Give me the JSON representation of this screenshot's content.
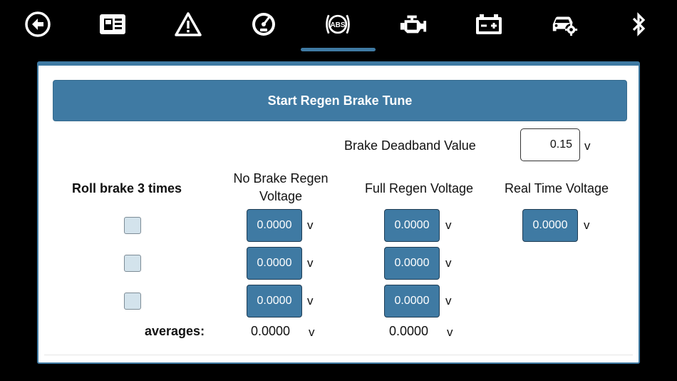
{
  "toolbar": {
    "icons": [
      "back-icon",
      "dashboard-icon",
      "warning-icon",
      "gauge-icon",
      "abs-icon",
      "engine-icon",
      "battery-icon",
      "car-settings-icon",
      "bluetooth-icon"
    ],
    "active": "abs-icon",
    "abs_text": "ABS"
  },
  "colors": {
    "accent": "#3f7aa3",
    "checkbox": "#d3e3ec",
    "background": "#000000"
  },
  "panel": {
    "start_button": "Start Regen Brake Tune",
    "deadband": {
      "label": "Brake Deadband Value",
      "value": "0.15",
      "unit": "v"
    },
    "headers": {
      "roll": "Roll brake 3 times",
      "no_brake_line1": "No Brake Regen",
      "no_brake_line2": "Voltage",
      "full_regen": "Full Regen Voltage",
      "real_time": "Real Time Voltage"
    },
    "rows": [
      {
        "no_brake": "0.0000",
        "full_regen": "0.0000"
      },
      {
        "no_brake": "0.0000",
        "full_regen": "0.0000"
      },
      {
        "no_brake": "0.0000",
        "full_regen": "0.0000"
      }
    ],
    "real_time_value": "0.0000",
    "unit": "v",
    "averages": {
      "label": "averages:",
      "no_brake": "0.0000",
      "full_regen": "0.0000"
    }
  }
}
